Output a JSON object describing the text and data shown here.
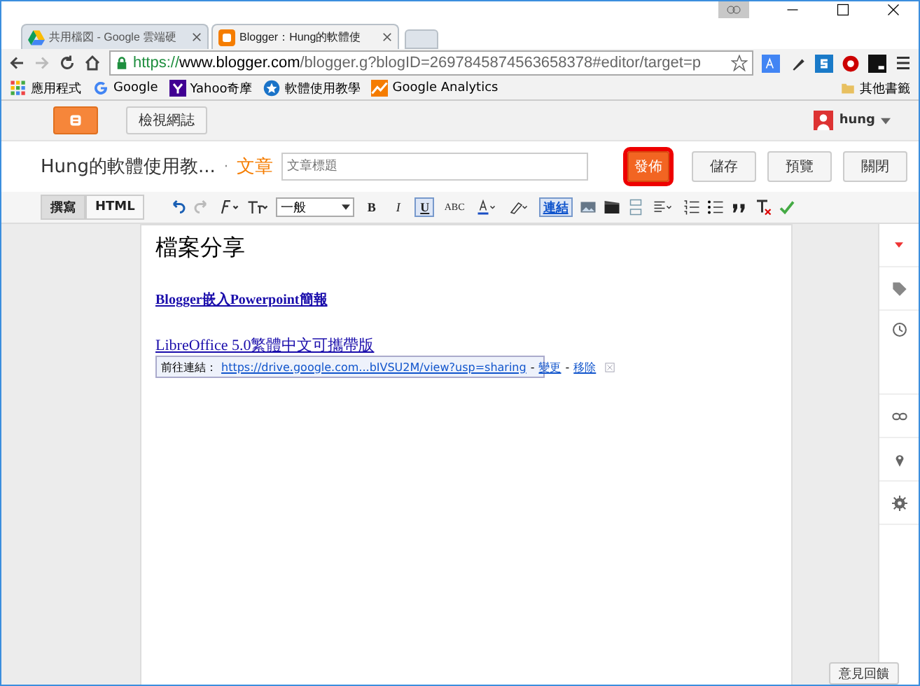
{
  "browser": {
    "tabs": [
      {
        "title": "共用檔図 - Google 雲端硬",
        "selected": false
      },
      {
        "title": "Blogger：Hung的軟體使",
        "selected": true
      }
    ],
    "url": {
      "scheme": "https://",
      "host": "www.blogger.com",
      "path": "/blogger.g?blogID=2697845874563658378#editor/target=p"
    },
    "bookmarks": [
      "應用程式",
      "Google",
      "Yahoo奇摩",
      "軟體使用教學",
      "Google Analytics"
    ],
    "other_bookmarks": "其他書籤"
  },
  "header": {
    "view_blog": "檢視網誌",
    "user": "hung"
  },
  "post_bar": {
    "blog_name": "Hung的軟體使用教...",
    "separator": "·",
    "section": "文章",
    "title_placeholder": "文章標題",
    "buttons": [
      {
        "label": "發佈",
        "kind": "primary",
        "highlighted": true
      },
      {
        "label": "儲存",
        "kind": "normal",
        "highlighted": false
      },
      {
        "label": "預覽",
        "kind": "normal",
        "highlighted": false
      },
      {
        "label": "關閉",
        "kind": "normal",
        "highlighted": false
      }
    ]
  },
  "toolbar": {
    "modes": [
      {
        "label": "撰寫",
        "selected": true
      },
      {
        "label": "HTML",
        "selected": false
      }
    ],
    "font_size": "一般",
    "format": [
      {
        "label": "B",
        "selected": false
      },
      {
        "label": "I",
        "selected": false
      },
      {
        "label": "U",
        "selected": true
      },
      {
        "label": "ABC",
        "selected": false
      }
    ],
    "link": {
      "label": "連結",
      "selected": true
    }
  },
  "editor": {
    "heading": "檔案分享",
    "links": [
      "Blogger嵌入Powerpoint簡報",
      "LibreOffice 5.0繁體中文可攜帶版"
    ],
    "link_popup": {
      "prefix": "前往連結：",
      "url": "https://drive.google.com...bIVSU2M/view?usp=sharing",
      "separator": "-",
      "actions": [
        "變更",
        "移除"
      ]
    }
  },
  "feedback": "意見回饋"
}
